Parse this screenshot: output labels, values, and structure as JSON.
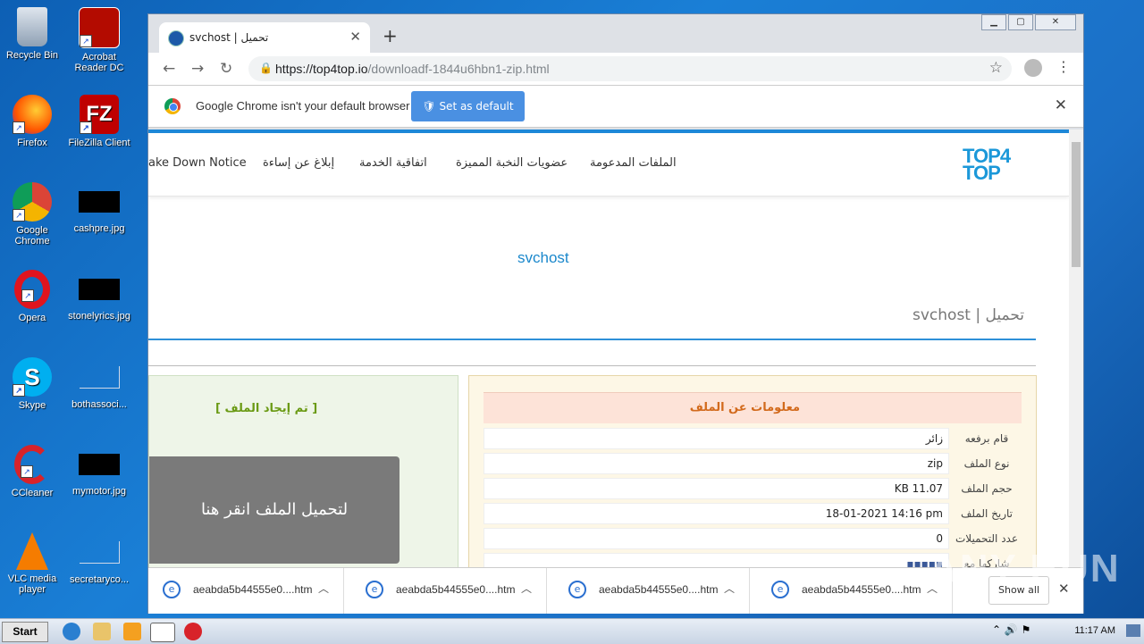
{
  "desktop": {
    "icons": [
      {
        "label": "Recycle Bin"
      },
      {
        "label": "Acrobat Reader DC"
      },
      {
        "label": "Firefox"
      },
      {
        "label": "FileZilla Client"
      },
      {
        "label": "Google Chrome"
      },
      {
        "label": "cashpre.jpg"
      },
      {
        "label": "Opera"
      },
      {
        "label": "stonelyrics.jpg"
      },
      {
        "label": "Skype"
      },
      {
        "label": "bothassoci..."
      },
      {
        "label": "CCleaner"
      },
      {
        "label": "mymotor.jpg"
      },
      {
        "label": "VLC media player"
      },
      {
        "label": "secretaryco..."
      }
    ]
  },
  "browser": {
    "tab_title": "svchost | تحميل",
    "url_host": "https://top4top.io",
    "url_path": "/downloadf-1844u6hbn1-zip.html",
    "infobar": {
      "message": "Google Chrome isn't your default browser",
      "button": "Set as default"
    }
  },
  "site": {
    "logo": "TOP4 TOP",
    "nav": [
      "الملفات المدعومة",
      "عضويات النخبة المميزة",
      "اتفاقية الخدمة",
      "إبلاغ عن إساءة",
      "ake Down Notice"
    ],
    "file_name": "svchost",
    "page_heading": "svchost | تحميل",
    "found_text": "[ تم إيجاد الملف ]",
    "download_button": "لتحميل الملف انقر هنا",
    "info_title": "معلومات عن الملف",
    "info_rows": [
      {
        "label": "قام برفعه",
        "value": "زائر"
      },
      {
        "label": "نوع الملف",
        "value": "zip"
      },
      {
        "label": "حجم الملف",
        "value": "KB 11.07"
      },
      {
        "label": "تاريخ الملف",
        "value": "18-01-2021 14:16 pm"
      },
      {
        "label": "عدد التحميلات",
        "value": "0"
      },
      {
        "label": "شاركها مع",
        "value": ""
      }
    ]
  },
  "downloads": {
    "items": [
      "aeabda5b44555e0....htm",
      "aeabda5b44555e0....htm",
      "aeabda5b44555e0....htm",
      "aeabda5b44555e0....htm"
    ],
    "show_all": "Show all"
  },
  "watermark": "ANY RUN",
  "taskbar": {
    "start": "Start",
    "clock": "11:17 AM"
  }
}
